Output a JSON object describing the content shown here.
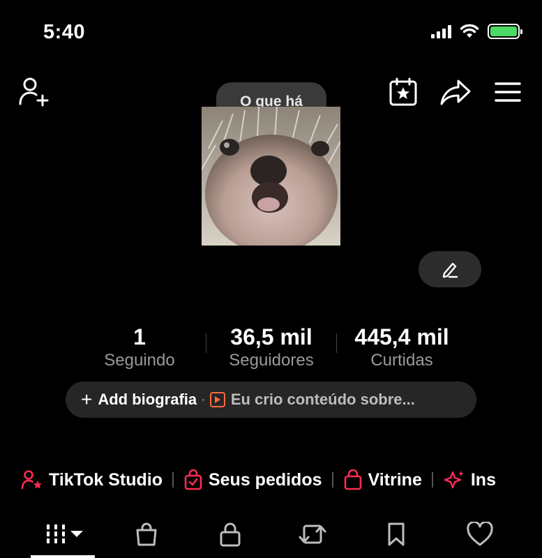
{
  "status_bar": {
    "time": "5:40"
  },
  "profile": {
    "notes_bubble_text": "O que há",
    "avatar_icon": "hedgehog-avatar",
    "stats": [
      {
        "value": "1",
        "label": "Seguindo"
      },
      {
        "value": "36,5 mil",
        "label": "Seguidores"
      },
      {
        "value": "445,4 mil",
        "label": "Curtidas"
      }
    ],
    "bio": {
      "plus": "+",
      "add_label": "Add biografia",
      "dot": "·",
      "hint": "Eu crio conteúdo sobre..."
    }
  },
  "quick_links": [
    {
      "label": "TikTok Studio",
      "icon": "person-star-icon"
    },
    {
      "label": "Seus pedidos",
      "icon": "order-bag-icon"
    },
    {
      "label": "Vitrine",
      "icon": "shop-bag-icon"
    },
    {
      "label": "Ins",
      "icon": "sparkle-icon"
    }
  ],
  "tabs": [
    {
      "name": "videos",
      "icon": "grid-icon",
      "active": true
    },
    {
      "name": "shop",
      "icon": "bag-icon"
    },
    {
      "name": "private",
      "icon": "lock-icon"
    },
    {
      "name": "reposts",
      "icon": "repost-icon"
    },
    {
      "name": "favorites",
      "icon": "bookmark-icon"
    },
    {
      "name": "liked",
      "icon": "heart-icon"
    }
  ],
  "colors": {
    "background": "#000000",
    "accent_pink": "#fe2c55",
    "accent_orange": "#ff6a3d",
    "battery_green": "#4cd964"
  }
}
